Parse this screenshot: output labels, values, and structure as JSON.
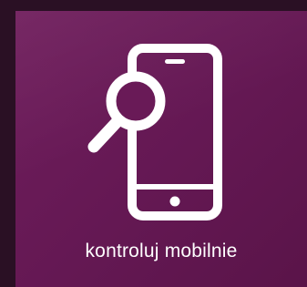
{
  "tile": {
    "label": "kontroluj mobilnie",
    "icon": "phone-search-icon",
    "background_color": "#661855",
    "page_background": "#2a1024",
    "icon_color": "#ffffff"
  }
}
